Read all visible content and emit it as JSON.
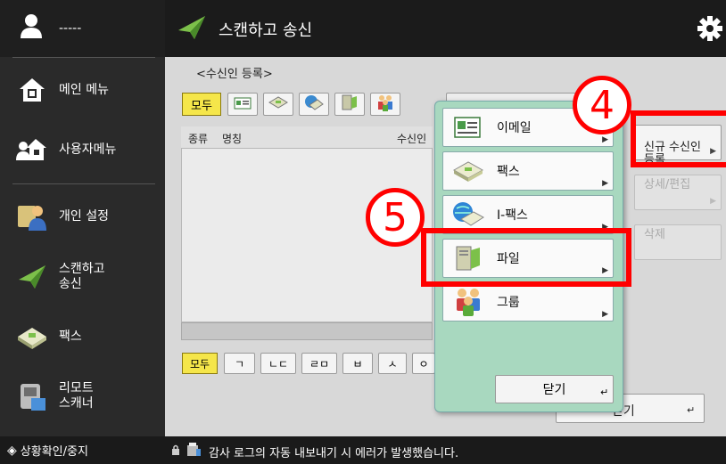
{
  "sidebar": {
    "user_name": "-----",
    "items": [
      {
        "label": "메인 메뉴"
      },
      {
        "label": "사용자메뉴"
      },
      {
        "label": "개인 설정"
      },
      {
        "label": "스캔하고\n송신"
      },
      {
        "label": "팩스"
      },
      {
        "label": "리모트\n스캐너"
      }
    ],
    "status_button": "상황확인/중지"
  },
  "header": {
    "title": "스캔하고 송신"
  },
  "screen": {
    "subtitle": "<수신인 등록>"
  },
  "filter_toolbar": {
    "all_label": "모두"
  },
  "list": {
    "col_type": "종류",
    "col_name": "명칭",
    "col_dest": "수신인"
  },
  "char_index": {
    "items": [
      "모두",
      "ㄱ",
      "ㄴㄷ",
      "ㄹㅁ",
      "ㅂ",
      "ㅅ",
      "ㅇ"
    ]
  },
  "right_panel": {
    "new_dest": "신규 수신인\n등록",
    "detail_edit": "상세/편집",
    "delete": "삭제"
  },
  "bg_close": "닫기",
  "popup": {
    "items": [
      {
        "label": "이메일"
      },
      {
        "label": "팩스"
      },
      {
        "label": "I-팩스"
      },
      {
        "label": "파일"
      },
      {
        "label": "그룹"
      }
    ],
    "close": "닫기"
  },
  "annotations": {
    "step4": "4",
    "step5": "5"
  },
  "status_bar": {
    "message": "감사 로그의 자동 내보내기 시 에러가 발생했습니다."
  },
  "colors": {
    "accent_yellow": "#f5e64a",
    "popup_bg": "#a8d8bf",
    "highlight_red": "#ff0000"
  }
}
